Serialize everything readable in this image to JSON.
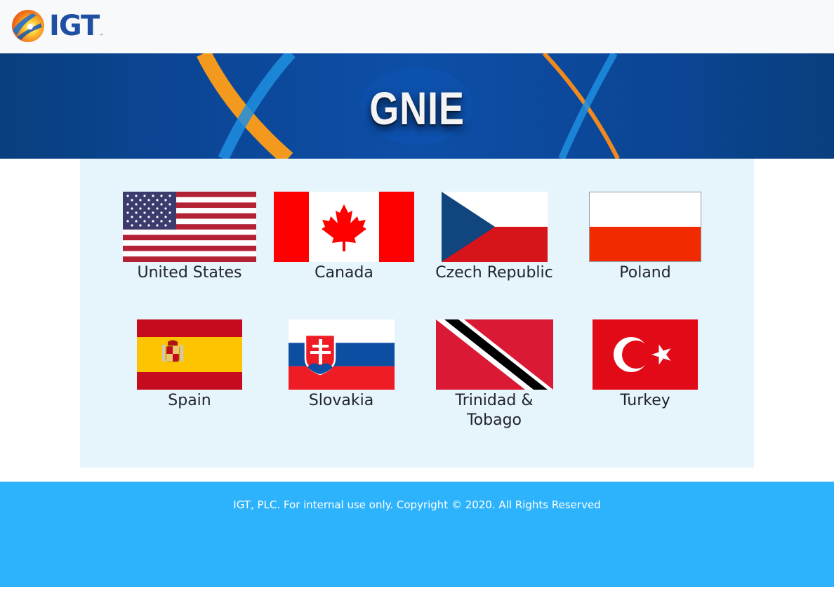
{
  "header": {
    "logo_text": "IGT",
    "logo_tm": "™"
  },
  "banner": {
    "title": "GNIE"
  },
  "countries": [
    {
      "name": "United States",
      "flag_icon": "us-flag-icon"
    },
    {
      "name": "Canada",
      "flag_icon": "canada-flag-icon"
    },
    {
      "name": "Czech Republic",
      "flag_icon": "czech-flag-icon"
    },
    {
      "name": "Poland",
      "flag_icon": "poland-flag-icon"
    },
    {
      "name": "Spain",
      "flag_icon": "spain-flag-icon"
    },
    {
      "name": "Slovakia",
      "flag_icon": "slovakia-flag-icon"
    },
    {
      "name": "Trinidad & Tobago",
      "flag_icon": "trinidad-tobago-flag-icon"
    },
    {
      "name": "Turkey",
      "flag_icon": "turkey-flag-icon"
    }
  ],
  "footer": {
    "text": "IGT, PLC. For internal use only. Copyright © 2020. All Rights Reserved"
  },
  "colors": {
    "banner_blue": "#0d4ea6",
    "panel_bg": "#e6f4fc",
    "footer_bg": "#2db3fc",
    "logo_blue": "#1f4fa3"
  }
}
